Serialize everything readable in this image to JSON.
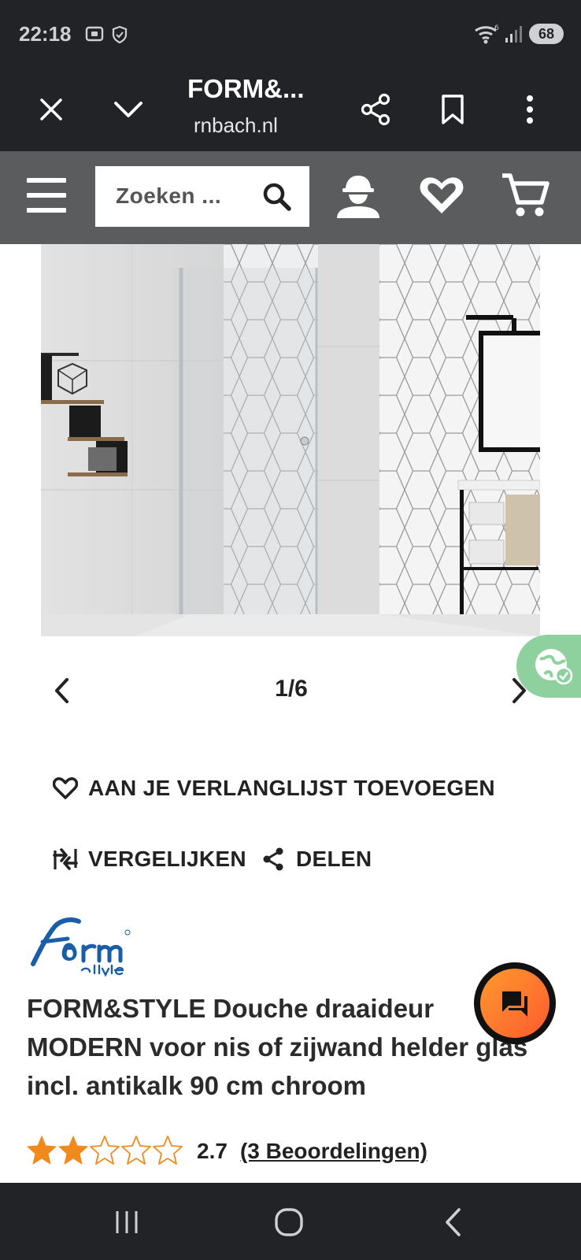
{
  "status_bar": {
    "time": "22:18",
    "battery": "68",
    "icons": [
      "screen-record-icon",
      "shield-icon",
      "wifi-icon",
      "signal-icon"
    ]
  },
  "browser": {
    "title": "FORM&...",
    "url": "rnbach.nl",
    "icons": [
      "close-icon",
      "chevron-down-icon",
      "share-icon",
      "bookmark-icon",
      "more-icon"
    ]
  },
  "header": {
    "search_placeholder": "Zoeken ...",
    "icons": [
      "menu-icon",
      "search-icon",
      "account-icon",
      "wishlist-icon",
      "cart-icon"
    ]
  },
  "gallery": {
    "counter": "1/6"
  },
  "actions": {
    "wishlist": "AAN JE VERLANGLIJST TOEVOEGEN",
    "compare": "VERGELIJKEN",
    "share": "DELEN"
  },
  "product": {
    "brand_logo_text": "form & style",
    "title": "FORM&STYLE Douche draaideur MODERN voor nis of zijwand helder glas incl. antikalk 90 cm chroom",
    "rating_value": 2.7,
    "rating_text": "2.7",
    "reviews_text": "(3 Beoordelingen)"
  },
  "colors": {
    "dark_bar": "#222326",
    "header_grey": "#5b5c5e",
    "star": "#f08a1c",
    "fab_orange": "#ff7a2e",
    "globe_green": "#8fd19e"
  }
}
